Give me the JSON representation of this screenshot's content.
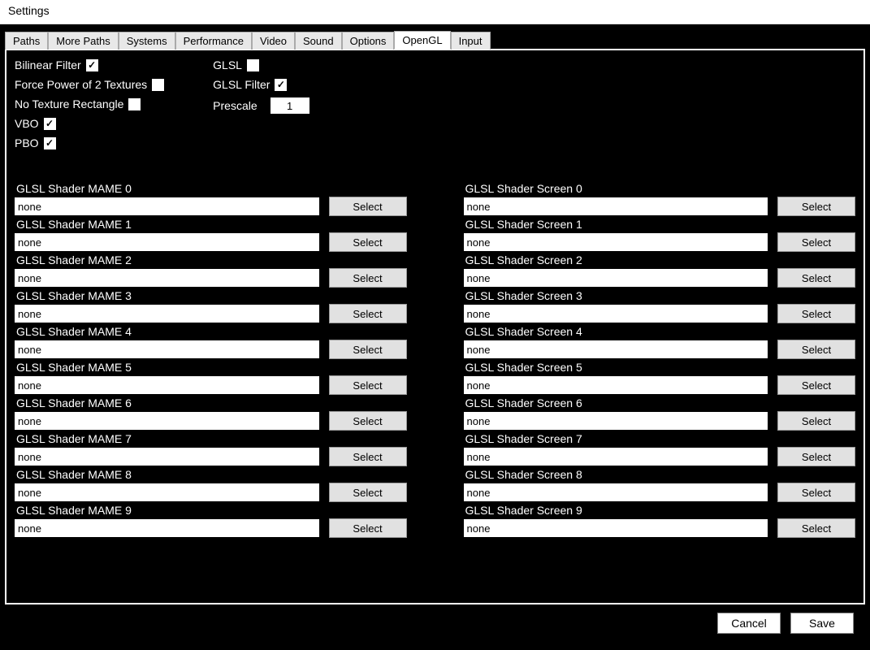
{
  "window": {
    "title": "Settings"
  },
  "tabs": [
    {
      "label": "Paths",
      "active": false
    },
    {
      "label": "More Paths",
      "active": false
    },
    {
      "label": "Systems",
      "active": false
    },
    {
      "label": "Performance",
      "active": false
    },
    {
      "label": "Video",
      "active": false
    },
    {
      "label": "Sound",
      "active": false
    },
    {
      "label": "Options",
      "active": false
    },
    {
      "label": "OpenGL",
      "active": true
    },
    {
      "label": "Input",
      "active": false
    }
  ],
  "options": {
    "col1": [
      {
        "label": "Bilinear Filter",
        "checked": true
      },
      {
        "label": "Force Power of 2 Textures",
        "checked": false
      },
      {
        "label": "No Texture Rectangle",
        "checked": false
      },
      {
        "label": "VBO",
        "checked": true
      },
      {
        "label": "PBO",
        "checked": true
      }
    ],
    "col2": [
      {
        "label": "GLSL",
        "checked": false,
        "type": "check"
      },
      {
        "label": "GLSL Filter",
        "checked": true,
        "type": "check"
      },
      {
        "label": "Prescale",
        "value": "1",
        "type": "num"
      }
    ]
  },
  "shaders": {
    "mame_prefix": "GLSL Shader MAME",
    "screen_prefix": "GLSL Shader Screen",
    "select_label": "Select",
    "mame": [
      {
        "idx": 0,
        "value": "none"
      },
      {
        "idx": 1,
        "value": "none"
      },
      {
        "idx": 2,
        "value": "none"
      },
      {
        "idx": 3,
        "value": "none"
      },
      {
        "idx": 4,
        "value": "none"
      },
      {
        "idx": 5,
        "value": "none"
      },
      {
        "idx": 6,
        "value": "none"
      },
      {
        "idx": 7,
        "value": "none"
      },
      {
        "idx": 8,
        "value": "none"
      },
      {
        "idx": 9,
        "value": "none"
      }
    ],
    "screen": [
      {
        "idx": 0,
        "value": "none"
      },
      {
        "idx": 1,
        "value": "none"
      },
      {
        "idx": 2,
        "value": "none"
      },
      {
        "idx": 3,
        "value": "none"
      },
      {
        "idx": 4,
        "value": "none"
      },
      {
        "idx": 5,
        "value": "none"
      },
      {
        "idx": 6,
        "value": "none"
      },
      {
        "idx": 7,
        "value": "none"
      },
      {
        "idx": 8,
        "value": "none"
      },
      {
        "idx": 9,
        "value": "none"
      }
    ]
  },
  "footer": {
    "cancel": "Cancel",
    "save": "Save"
  }
}
